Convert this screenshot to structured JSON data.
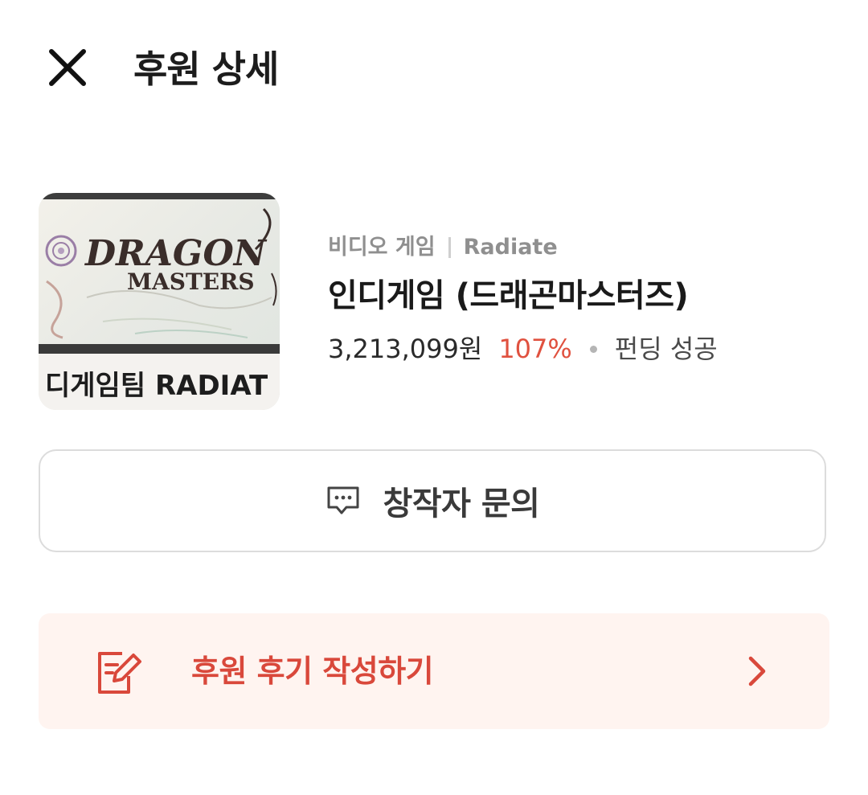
{
  "header": {
    "title": "후원 상세",
    "close_icon": "close-icon"
  },
  "project": {
    "thumbnail": {
      "logo_line1": "DRAGON",
      "logo_line2": "MASTERS",
      "caption": "디게임팀 RADIAT"
    },
    "category": "비디오 게임",
    "creator": "Radiate",
    "title": "인디게임 (드래곤마스터즈)",
    "amount": "3,213,099원",
    "rate": "107%",
    "status": "펀딩 성공"
  },
  "actions": {
    "inquiry_label": "창작자 문의",
    "inquiry_icon": "chat-icon",
    "review_label": "후원 후기 작성하기",
    "review_icon": "edit-note-icon",
    "review_chevron": "chevron-right-icon"
  },
  "colors": {
    "accent": "#d9483b",
    "rate": "#e0513f",
    "review_bg": "#fff4f0",
    "muted": "#8f8f8f"
  }
}
